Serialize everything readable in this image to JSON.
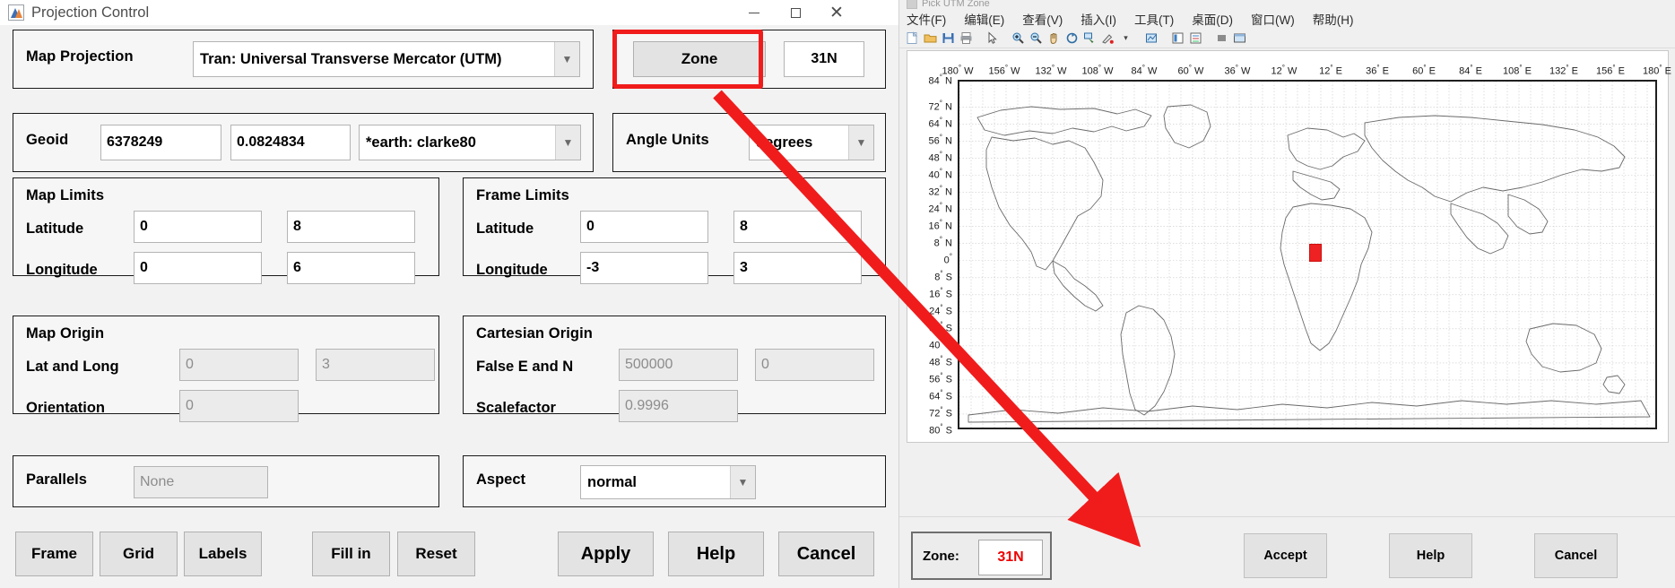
{
  "projection_window": {
    "title": "Projection Control",
    "window_buttons": {
      "minimize": "–",
      "maximize": "☐",
      "close": "✕"
    },
    "map_projection": {
      "label": "Map Projection",
      "value": "Tran: Universal Transverse Mercator (UTM)"
    },
    "zone": {
      "button_label": "Zone",
      "value": "31N"
    },
    "geoid": {
      "label": "Geoid",
      "semimajor_axis": "6378249",
      "eccentricity": "0.0824834",
      "name": "*earth: clarke80"
    },
    "angle_units": {
      "label": "Angle Units",
      "value": "degrees"
    },
    "map_limits": {
      "title": "Map Limits",
      "latitude_label": "Latitude",
      "latitude_min": "0",
      "latitude_max": "8",
      "longitude_label": "Longitude",
      "longitude_min": "0",
      "longitude_max": "6"
    },
    "frame_limits": {
      "title": "Frame Limits",
      "latitude_label": "Latitude",
      "latitude_min": "0",
      "latitude_max": "8",
      "longitude_label": "Longitude",
      "longitude_min": "-3",
      "longitude_max": "3"
    },
    "map_origin": {
      "title": "Map Origin",
      "lat_long_label": "Lat and Long",
      "lat": "0",
      "long": "3",
      "orientation_label": "Orientation",
      "orientation": "0"
    },
    "cartesian_origin": {
      "title": "Cartesian Origin",
      "false_en_label": "False E and N",
      "false_easting": "500000",
      "false_northing": "0",
      "scalefactor_label": "Scalefactor",
      "scalefactor": "0.9996"
    },
    "parallels": {
      "label": "Parallels",
      "value": "None"
    },
    "aspect": {
      "label": "Aspect",
      "value": "normal"
    },
    "buttons": {
      "frame": "Frame",
      "grid": "Grid",
      "labels": "Labels",
      "fill_in": "Fill in",
      "reset": "Reset",
      "apply": "Apply",
      "help": "Help",
      "cancel": "Cancel"
    }
  },
  "figure_window": {
    "title": "Pick UTM Zone",
    "menus": [
      "文件(F)",
      "编辑(E)",
      "查看(V)",
      "插入(I)",
      "工具(T)",
      "桌面(D)",
      "窗口(W)",
      "帮助(H)"
    ],
    "toolbar_icons": [
      "new-file-icon",
      "open-folder-icon",
      "save-icon",
      "print-icon",
      "pointer-icon",
      "zoom-in-icon",
      "zoom-out-icon",
      "pan-icon",
      "rotate-3d-icon",
      "data-cursor-icon",
      "brush-icon",
      "dropdown-arrow-icon",
      "link-data-icon",
      "colorbar-icon",
      "legend-icon",
      "hide-plot-tools-icon",
      "show-plot-tools-icon"
    ],
    "zone_panel": {
      "label": "Zone:",
      "value": "31N",
      "accept": "Accept",
      "help": "Help",
      "cancel": "Cancel"
    }
  },
  "chart_data": {
    "type": "map",
    "title": "Pick UTM Zone",
    "projection": "Universal Transverse Mercator zone picker (world grid)",
    "xlabel": "",
    "ylabel": "",
    "xticks": [
      "180° W",
      "156° W",
      "132° W",
      "108° W",
      "84° W",
      "60° W",
      "36° W",
      "12° W",
      "12° E",
      "36° E",
      "60° E",
      "84° E",
      "108° E",
      "132° E",
      "156° E",
      "180° E"
    ],
    "xtick_values": [
      -180,
      -156,
      -132,
      -108,
      -84,
      -60,
      -36,
      -12,
      12,
      36,
      60,
      84,
      108,
      132,
      156,
      180
    ],
    "yticks": [
      "84° N",
      "72° N",
      "64° N",
      "56° N",
      "48° N",
      "40° N",
      "32° N",
      "24° N",
      "16° N",
      "8° N",
      "0°",
      "8° S",
      "16° S",
      "24° S",
      "32° S",
      "40° S",
      "48° S",
      "56° S",
      "64° S",
      "72° S",
      "80° S"
    ],
    "ytick_values": [
      84,
      72,
      64,
      56,
      48,
      40,
      32,
      24,
      16,
      8,
      0,
      -8,
      -16,
      -24,
      -32,
      -40,
      -48,
      -56,
      -64,
      -72,
      -80
    ],
    "xlim": [
      -180,
      180
    ],
    "ylim": [
      -80,
      84
    ],
    "grid": true,
    "annotations": [
      {
        "name": "selected-zone",
        "label": "31N",
        "lon_range": [
          0,
          6
        ],
        "lat_range": [
          0,
          8
        ],
        "color": "#ee2222"
      }
    ],
    "legend": null
  },
  "annotation_overlay": {
    "highlight_color": "#f01c1c",
    "arrow_color": "#f01c1c",
    "arrow_from": "Zone button in Projection Control",
    "arrow_to": "Zone: 31N field in Pick UTM Zone figure"
  }
}
